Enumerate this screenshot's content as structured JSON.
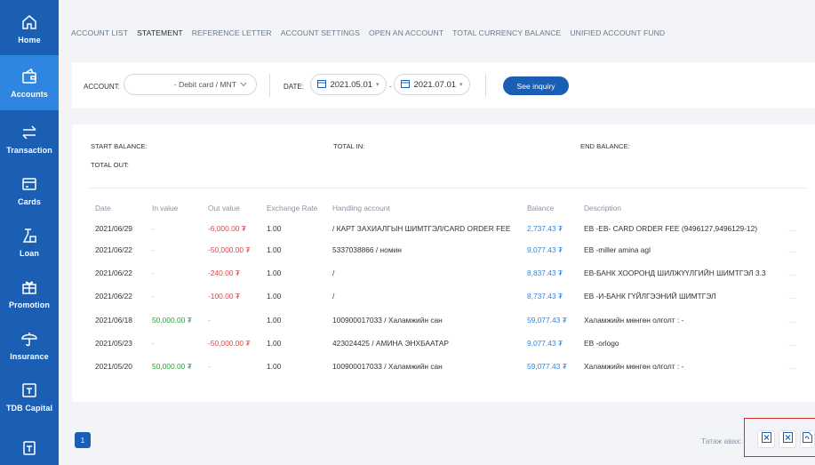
{
  "sidebar": {
    "items": [
      {
        "label": "Home",
        "icon": "home-icon"
      },
      {
        "label": "Accounts",
        "icon": "wallet-icon"
      },
      {
        "label": "Transaction",
        "icon": "transfer-arrows-icon"
      },
      {
        "label": "Cards",
        "icon": "card-icon"
      },
      {
        "label": "Loan",
        "icon": "loan-icon"
      },
      {
        "label": "Promotion",
        "icon": "gift-icon"
      },
      {
        "label": "Insurance",
        "icon": "umbrella-icon"
      },
      {
        "label": "TDB Capital",
        "icon": "capital-icon"
      },
      {
        "label": "",
        "icon": "document-icon"
      }
    ],
    "active_index": 1,
    "color": "#1a5fb4",
    "active_color": "#2f86e0"
  },
  "tabs": [
    {
      "label": "ACCOUNT LIST"
    },
    {
      "label": "STATEMENT"
    },
    {
      "label": "REFERENCE LETTER"
    },
    {
      "label": "ACCOUNT SETTINGS"
    },
    {
      "label": "OPEN AN ACCOUNT"
    },
    {
      "label": "TOTAL CURRENCY BALANCE"
    },
    {
      "label": "UNIFIED ACCOUNT FUND"
    }
  ],
  "active_tab": "STATEMENT",
  "filter": {
    "account_label": "ACCOUNT:",
    "account_value": "- Debit card / MNT",
    "date_label": "DATE:",
    "date_from": "2021.05.01",
    "date_to": "2021.07.01",
    "date_separator": "-",
    "button_label": "See inquiry"
  },
  "balances": {
    "start_label": "START BALANCE:",
    "total_in_label": "TOTAL IN:",
    "end_label": "END BALANCE:",
    "total_out_label": "TOTAL OUT:"
  },
  "table": {
    "headers": [
      "Date",
      "In value",
      "Out value",
      "Exchange Rate",
      "Handling account",
      "Balance",
      "Description"
    ],
    "rows": [
      {
        "date": "2021/06/29",
        "in": "-",
        "out": "-6,000.00 ₮",
        "rate": "1.00",
        "account": "/ КАРТ ЗАХИАЛГЫН ШИМТГЭЛ/CARD ORDER FEE",
        "balance": "2,737.43 ₮",
        "description": "EB -EB- CARD ORDER FEE (9496127,9496129-12)",
        "more": "..."
      },
      {
        "date": "2021/06/22",
        "in": "-",
        "out": "-50,000.00 ₮",
        "rate": "1.00",
        "account": "5337038866 / номин",
        "balance": "9,077.43 ₮",
        "description": "EB -miller amina agl",
        "more": "..."
      },
      {
        "date": "2021/06/22",
        "in": "-",
        "out": "-240.00 ₮",
        "rate": "1.00",
        "account": "/",
        "balance": "8,837.43 ₮",
        "description": "ЕВ-БАНК ХООРОНД ШИЛЖҮҮЛГИЙН ШИМТГЭЛ 3.3",
        "more": "..."
      },
      {
        "date": "2021/06/22",
        "in": "-",
        "out": "-100.00 ₮",
        "rate": "1.00",
        "account": "/",
        "balance": "8,737.43 ₮",
        "description": "ЕВ -И-БАНК ГҮЙЛГЭЭНИЙ ШИМТГЭЛ",
        "more": "..."
      },
      {
        "date": "2021/06/18",
        "in": "50,000.00 ₮",
        "out": "-",
        "rate": "1.00",
        "account": "100900017033 / Халамжийн сан",
        "balance": "59,077.43 ₮",
        "description": "Халамжийн мөнгөн олголт : -",
        "more": "..."
      },
      {
        "date": "2021/05/23",
        "in": "-",
        "out": "-50,000.00 ₮",
        "rate": "1.00",
        "account": "423024425 / АМИНА ЭНХБААТАР",
        "balance": "9,077.43 ₮",
        "description": "EB -orlogo",
        "more": "..."
      },
      {
        "date": "2021/05/20",
        "in": "50,000.00 ₮",
        "out": "-",
        "rate": "1.00",
        "account": "100900017033 / Халамжийн сан",
        "balance": "59,077.43 ₮",
        "description": "Халамжийн мөнгөн олголт : -",
        "more": "..."
      }
    ]
  },
  "pagination": {
    "current_page": "1"
  },
  "download": {
    "label": "Татаж авах:",
    "buttons": [
      {
        "icon": "excel-icon"
      },
      {
        "icon": "excel-icon"
      },
      {
        "icon": "pdf-icon"
      }
    ]
  },
  "colors": {
    "primary": "#1a5fb4",
    "negative": "#e04646",
    "positive": "#2f9e3e",
    "balance": "#2f86e0",
    "highlight": "#e02b2b"
  }
}
